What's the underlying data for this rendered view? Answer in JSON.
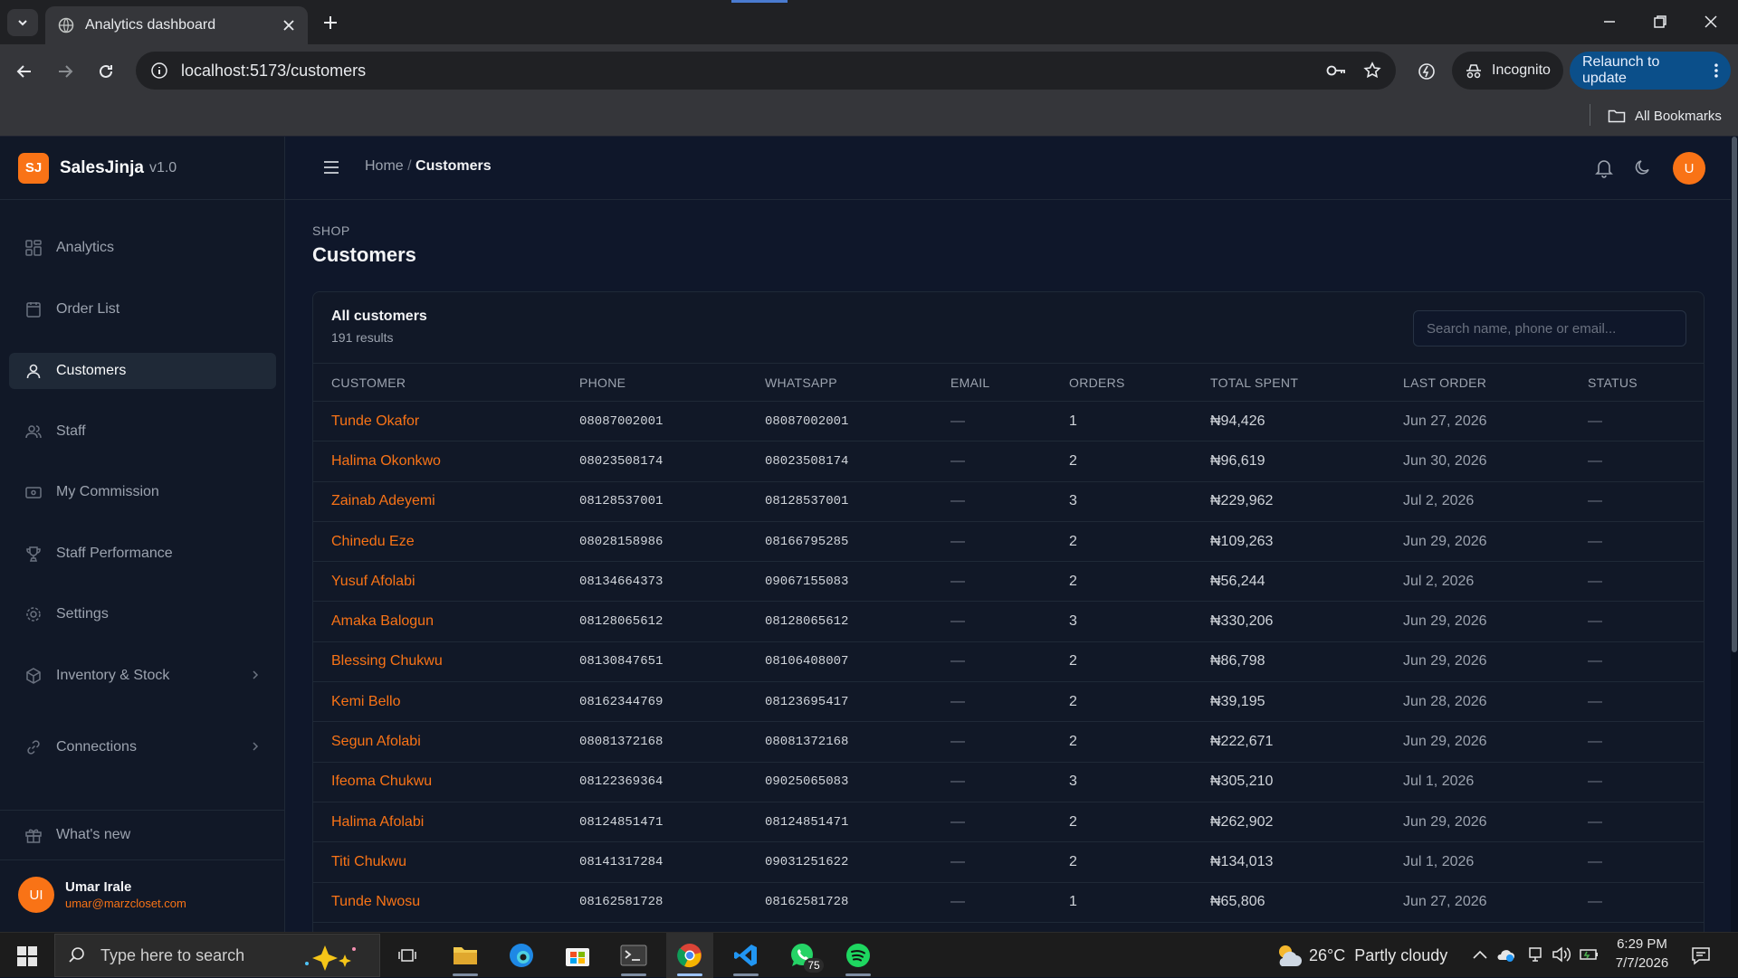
{
  "browser": {
    "tab_title": "Analytics dashboard",
    "url": "localhost:5173/customers",
    "incognito_label": "Incognito",
    "relaunch_label": "Relaunch to update",
    "bookmarks_label": "All Bookmarks"
  },
  "app": {
    "brand_initials": "SJ",
    "brand_name": "SalesJinja",
    "version": "v1.0"
  },
  "sidebar": {
    "items": [
      {
        "label": "Analytics",
        "icon": "grid-icon"
      },
      {
        "label": "Order List",
        "icon": "clipboard-icon"
      },
      {
        "label": "Customers",
        "icon": "user-icon"
      },
      {
        "label": "Staff",
        "icon": "users-icon"
      },
      {
        "label": "My Commission",
        "icon": "wallet-icon"
      },
      {
        "label": "Staff Performance",
        "icon": "trophy-icon"
      },
      {
        "label": "Settings",
        "icon": "gear-icon"
      },
      {
        "label": "Inventory & Stock",
        "icon": "box-icon"
      },
      {
        "label": "Connections",
        "icon": "link-icon"
      }
    ],
    "whats_new": "What's new",
    "user": {
      "initials": "UI",
      "name": "Umar Irale",
      "email": "umar@marzcloset.com"
    }
  },
  "header": {
    "breadcrumb_home": "Home",
    "breadcrumb_sep": "/",
    "breadcrumb_current": "Customers",
    "avatar_initial": "U"
  },
  "page": {
    "eyebrow": "SHOP",
    "title": "Customers"
  },
  "card": {
    "title": "All customers",
    "count": "191 results",
    "search_placeholder": "Search name, phone or email..."
  },
  "table": {
    "columns": [
      "CUSTOMER",
      "PHONE",
      "WHATSAPP",
      "EMAIL",
      "ORDERS",
      "TOTAL SPENT",
      "LAST ORDER",
      "STATUS"
    ],
    "rows": [
      {
        "name": "Tunde Okafor",
        "phone": "08087002001",
        "whatsapp": "08087002001",
        "email": "—",
        "orders": "1",
        "spent": "₦94,426",
        "last": "Jun 27, 2026",
        "status": "—"
      },
      {
        "name": "Halima Okonkwo",
        "phone": "08023508174",
        "whatsapp": "08023508174",
        "email": "—",
        "orders": "2",
        "spent": "₦96,619",
        "last": "Jun 30, 2026",
        "status": "—"
      },
      {
        "name": "Zainab Adeyemi",
        "phone": "08128537001",
        "whatsapp": "08128537001",
        "email": "—",
        "orders": "3",
        "spent": "₦229,962",
        "last": "Jul 2, 2026",
        "status": "—"
      },
      {
        "name": "Chinedu Eze",
        "phone": "08028158986",
        "whatsapp": "08166795285",
        "email": "—",
        "orders": "2",
        "spent": "₦109,263",
        "last": "Jun 29, 2026",
        "status": "—"
      },
      {
        "name": "Yusuf Afolabi",
        "phone": "08134664373",
        "whatsapp": "09067155083",
        "email": "—",
        "orders": "2",
        "spent": "₦56,244",
        "last": "Jul 2, 2026",
        "status": "—"
      },
      {
        "name": "Amaka Balogun",
        "phone": "08128065612",
        "whatsapp": "08128065612",
        "email": "—",
        "orders": "3",
        "spent": "₦330,206",
        "last": "Jun 29, 2026",
        "status": "—"
      },
      {
        "name": "Blessing Chukwu",
        "phone": "08130847651",
        "whatsapp": "08106408007",
        "email": "—",
        "orders": "2",
        "spent": "₦86,798",
        "last": "Jun 29, 2026",
        "status": "—"
      },
      {
        "name": "Kemi Bello",
        "phone": "08162344769",
        "whatsapp": "08123695417",
        "email": "—",
        "orders": "2",
        "spent": "₦39,195",
        "last": "Jun 28, 2026",
        "status": "—"
      },
      {
        "name": "Segun Afolabi",
        "phone": "08081372168",
        "whatsapp": "08081372168",
        "email": "—",
        "orders": "2",
        "spent": "₦222,671",
        "last": "Jun 29, 2026",
        "status": "—"
      },
      {
        "name": "Ifeoma Chukwu",
        "phone": "08122369364",
        "whatsapp": "09025065083",
        "email": "—",
        "orders": "3",
        "spent": "₦305,210",
        "last": "Jul 1, 2026",
        "status": "—"
      },
      {
        "name": "Halima Afolabi",
        "phone": "08124851471",
        "whatsapp": "08124851471",
        "email": "—",
        "orders": "2",
        "spent": "₦262,902",
        "last": "Jun 29, 2026",
        "status": "—"
      },
      {
        "name": "Titi Chukwu",
        "phone": "08141317284",
        "whatsapp": "09031251622",
        "email": "—",
        "orders": "2",
        "spent": "₦134,013",
        "last": "Jul 1, 2026",
        "status": "—"
      },
      {
        "name": "Tunde Nwosu",
        "phone": "08162581728",
        "whatsapp": "08162581728",
        "email": "—",
        "orders": "1",
        "spent": "₦65,806",
        "last": "Jun 27, 2026",
        "status": "—"
      }
    ]
  },
  "taskbar": {
    "search_placeholder": "Type here to search",
    "weather": "26°C  Partly cloudy",
    "time": "6:29 PM",
    "date": "7/7/2026",
    "whatsapp_badge": "75"
  },
  "colors": {
    "accent": "#f97316",
    "sidebar_bg": "#111827",
    "main_bg": "#0f172a",
    "relaunch_bg": "#0b4f8a"
  }
}
